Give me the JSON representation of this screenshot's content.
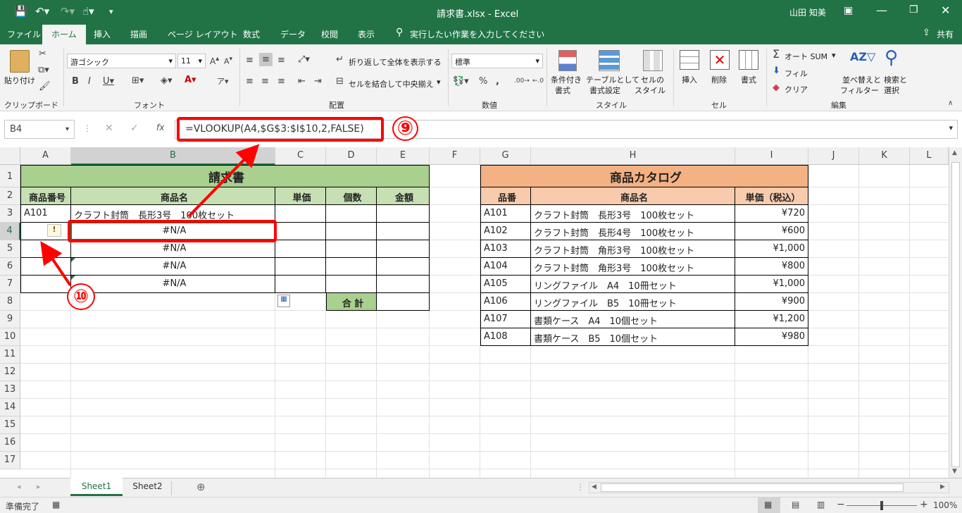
{
  "title_bar": {
    "document": "請求書.xlsx - Excel",
    "user": "山田 知美"
  },
  "tabs": [
    "ファイル",
    "ホーム",
    "挿入",
    "描画",
    "ページ レイアウト",
    "数式",
    "データ",
    "校閲",
    "表示"
  ],
  "tell_me": "実行したい作業を入力してください",
  "share": "共有",
  "ribbon": {
    "paste": "貼り付け",
    "clipboard": "クリップボード",
    "font_name": "游ゴシック",
    "font_size": "11",
    "font_group": "フォント",
    "wrap_text": "折り返して全体を表示する",
    "merge_center": "セルを結合して中央揃え",
    "alignment_group": "配置",
    "number_format": "標準",
    "number_group": "数値",
    "cond_format": "条件付き",
    "cond_format2": "書式",
    "format_table": "テーブルとして",
    "format_table2": "書式設定",
    "cell_styles": "セルの",
    "cell_styles2": "スタイル",
    "styles_group": "スタイル",
    "insert": "挿入",
    "delete": "削除",
    "format": "書式",
    "cells_group": "セル",
    "autosum": "オート SUM",
    "fill": "フィル",
    "clear": "クリア",
    "sort_filter": "並べ替えと",
    "sort_filter2": "フィルター",
    "find_select": "検索と",
    "find_select2": "選択",
    "editing_group": "編集"
  },
  "name_box": "B4",
  "formula": "=VLOOKUP(A4,$G$3:$I$10,2,FALSE)",
  "columns": [
    "A",
    "B",
    "C",
    "D",
    "E",
    "F",
    "G",
    "H",
    "I",
    "J",
    "K",
    "L"
  ],
  "rows": [
    "1",
    "2",
    "3",
    "4",
    "5",
    "6",
    "7",
    "8",
    "9",
    "10",
    "11",
    "12",
    "13",
    "14",
    "15",
    "16",
    "17"
  ],
  "invoice": {
    "title": "請求書",
    "headers": [
      "商品番号",
      "商品名",
      "単価",
      "個数",
      "金額"
    ],
    "a3": "A101",
    "b3": "クラフト封筒　長形3号　100枚セット",
    "na": "#N/A",
    "total": "合 計"
  },
  "catalog": {
    "title": "商品カタログ",
    "headers": [
      "品番",
      "商品名",
      "単価（税込）"
    ],
    "rows": [
      [
        "A101",
        "クラフト封筒　長形3号　100枚セット",
        "¥720"
      ],
      [
        "A102",
        "クラフト封筒　長形4号　100枚セット",
        "¥600"
      ],
      [
        "A103",
        "クラフト封筒　角形3号　100枚セット",
        "¥1,000"
      ],
      [
        "A104",
        "クラフト封筒　角形3号　100枚セット",
        "¥800"
      ],
      [
        "A105",
        "リングファイル　A4　10冊セット",
        "¥1,000"
      ],
      [
        "A106",
        "リングファイル　B5　10冊セット",
        "¥900"
      ],
      [
        "A107",
        "書類ケース　A4　10個セット",
        "¥1,200"
      ],
      [
        "A108",
        "書類ケース　B5　10個セット",
        "¥980"
      ]
    ]
  },
  "annotations": {
    "step9": "⑨",
    "step10": "⑩"
  },
  "sheets": [
    "Sheet1",
    "Sheet2"
  ],
  "status": "準備完了",
  "zoom": "100%",
  "colors": {
    "excel_green": "#217346",
    "invoice_header": "#a9d08e",
    "invoice_subheader": "#c6e0b4",
    "catalog_header": "#f4b183",
    "catalog_subheader": "#f8cbad",
    "annotation_red": "#ff0000"
  }
}
